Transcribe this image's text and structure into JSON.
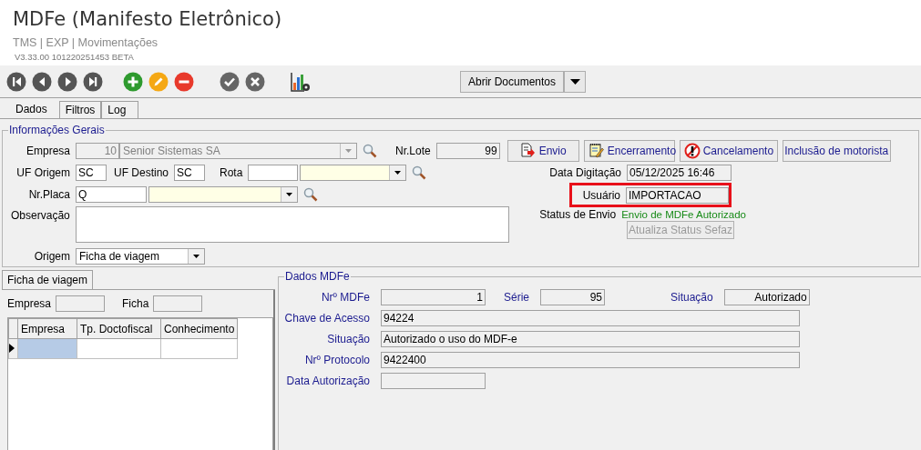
{
  "window": {
    "title": "MDFe (Manifesto Eletrônico)",
    "breadcrumb": "TMS | EXP | Movimentações",
    "version": "V3.33.00 101220251453 BETA"
  },
  "toolbar": {
    "buttons": [
      {
        "kind": "first"
      },
      {
        "kind": "previous"
      },
      {
        "kind": "next"
      },
      {
        "kind": "last"
      },
      {
        "kind": "add"
      },
      {
        "kind": "edit"
      },
      {
        "kind": "remove"
      },
      {
        "kind": "confirm"
      },
      {
        "kind": "cancel"
      },
      {
        "kind": "report"
      }
    ],
    "dropdown_button": {
      "label": "Abrir Documentos"
    }
  },
  "tabs": [
    {
      "label": "Dados",
      "selected": true
    },
    {
      "label": "Filtros",
      "selected": false
    },
    {
      "label": "Log",
      "selected": false
    }
  ],
  "general_info": {
    "title": "Informações Gerais",
    "empresa": {
      "label": "Empresa",
      "code": "10",
      "name": "Senior Sistemas SA",
      "disabled": true
    },
    "lote": {
      "label": "Nr.Lote",
      "value": "99"
    },
    "actions": [
      {
        "label": "Envio",
        "kind": "send"
      },
      {
        "label": "Encerramento",
        "kind": "close"
      },
      {
        "label": "Cancelamento",
        "kind": "cancel"
      },
      {
        "label": "Inclusão de motorista",
        "kind": "plain"
      }
    ],
    "uf_origem": {
      "label": "UF Origem",
      "value": "SC"
    },
    "uf_destino": {
      "label": "UF Destino",
      "value": "SC"
    },
    "rota": {
      "label": "Rota"
    },
    "placa": {
      "label": "Nr.Placa",
      "value": "Q"
    },
    "observacao": {
      "label": "Observação"
    },
    "origem": {
      "label": "Origem",
      "value": "Ficha de viagem"
    },
    "data_digitacao": {
      "label": "Data Digitação",
      "value": "05/12/2025 16:46"
    },
    "usuario": {
      "label": "Usuário",
      "value": "IMPORTACAO",
      "highlighted": true
    },
    "status": {
      "label": "Status de Envio",
      "value": "Envio de MDFe Autorizado"
    },
    "refresh_button": {
      "label": "Atualiza Status Sefaz",
      "disabled": true
    }
  },
  "ficha": {
    "tab": {
      "label": "Ficha de viagem",
      "selected": true
    },
    "empresa_label": "Empresa",
    "ficha_label": "Ficha",
    "table": {
      "columns": [
        "Empresa",
        "Tp. Doctofiscal",
        "Conhecimento"
      ],
      "rows": [
        {
          "current": true,
          "cells": [
            {
              "selected": true
            },
            {
              "selected": false
            },
            {
              "selected": false
            }
          ]
        }
      ]
    }
  },
  "mdfe": {
    "title": "Dados MDFe",
    "numero": {
      "label": "Nrº MDFe",
      "value": "1"
    },
    "serie": {
      "label": "Série",
      "value": "95"
    },
    "situacao": {
      "label": "Situação",
      "value": "Autorizado"
    },
    "chave": {
      "label": "Chave de Acesso",
      "value": "94224"
    },
    "situacao_texto": {
      "label": "Situação",
      "value": "Autorizado o uso do MDF-e"
    },
    "protocolo": {
      "label": "Nrº Protocolo",
      "value": "9422400"
    },
    "data_autorizacao": {
      "label": "Data Autorização"
    }
  }
}
